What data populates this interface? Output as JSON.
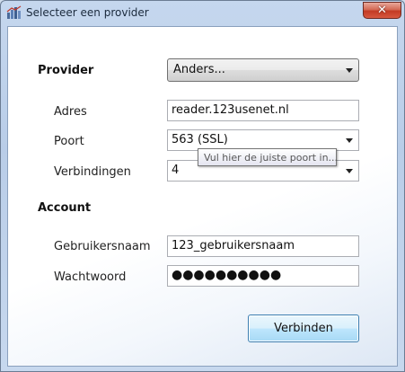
{
  "window": {
    "title": "Selecteer een provider",
    "close_glyph": "✕"
  },
  "provider": {
    "section_label": "Provider",
    "selected": "Anders..."
  },
  "server": {
    "address_label": "Adres",
    "address_value": "reader.123usenet.nl",
    "port_label": "Poort",
    "port_value": "563 (SSL)",
    "port_tooltip": "Vul hier de juiste poort in...",
    "connections_label": "Verbindingen",
    "connections_value": "4"
  },
  "account": {
    "section_label": "Account",
    "username_label": "Gebruikersnaam",
    "username_value": "123_gebruikersnaam",
    "password_label": "Wachtwoord",
    "password_masked": "●●●●●●●●●●"
  },
  "actions": {
    "connect_label": "Verbinden"
  },
  "icons": {
    "app": "app-icon",
    "close": "close-icon",
    "dropdown": "chevron-down-icon"
  }
}
